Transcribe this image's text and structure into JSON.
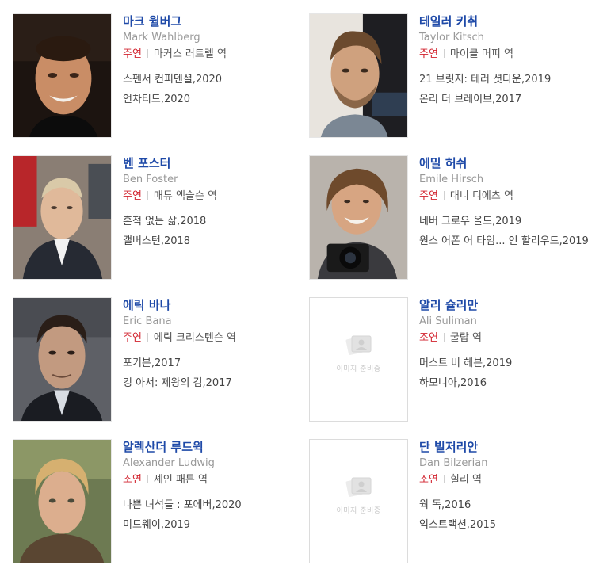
{
  "cast": [
    {
      "name_ko": "마크 월버그",
      "name_en": "Mark Wahlberg",
      "role_type": "주연",
      "role": "마커스 러트렐 역",
      "works": [
        "스펜서 컨피덴셜,2020",
        "언차티드,2020"
      ],
      "photo": "portrait"
    },
    {
      "name_ko": "테일러 키취",
      "name_en": "Taylor Kitsch",
      "role_type": "주연",
      "role": "마이클 머피 역",
      "works": [
        "21 브릿지: 테러 셧다운,2019",
        "온리 더 브레이브,2017"
      ],
      "photo": "portrait"
    },
    {
      "name_ko": "벤 포스터",
      "name_en": "Ben Foster",
      "role_type": "주연",
      "role": "매튜 액슬슨 역",
      "works": [
        "흔적 없는 삶,2018",
        "갤버스턴,2018"
      ],
      "photo": "portrait"
    },
    {
      "name_ko": "에밀 허쉬",
      "name_en": "Emile Hirsch",
      "role_type": "주연",
      "role": "대니 디에츠 역",
      "works": [
        "네버 그로우 올드,2019",
        "원스 어폰 어 타임... 인 할리우드,2019"
      ],
      "photo": "portrait"
    },
    {
      "name_ko": "에릭 바나",
      "name_en": "Eric Bana",
      "role_type": "주연",
      "role": "에릭 크리스텐슨 역",
      "works": [
        "포기븐,2017",
        "킹 아서: 제왕의 검,2017"
      ],
      "photo": "portrait"
    },
    {
      "name_ko": "알리 슐리만",
      "name_en": "Ali Suliman",
      "role_type": "조연",
      "role": "굴랍 역",
      "works": [
        "머스트 비 헤븐,2019",
        "하모니아,2016"
      ],
      "photo": "placeholder",
      "placeholder_text": "이미지 준비중"
    },
    {
      "name_ko": "알렉산더 루드윅",
      "name_en": "Alexander Ludwig",
      "role_type": "조연",
      "role": "셰인 패튼 역",
      "works": [
        "나쁜 녀석들 : 포에버,2020",
        "미드웨이,2019"
      ],
      "photo": "portrait"
    },
    {
      "name_ko": "단 빌저리안",
      "name_en": "Dan Bilzerian",
      "role_type": "조연",
      "role": "힐리 역",
      "works": [
        "웍 독,2016",
        "익스트랙션,2015"
      ],
      "photo": "placeholder",
      "placeholder_text": "이미지 준비중"
    }
  ],
  "colors": {
    "name_link": "#1f4aa8",
    "role_type": "#d2222d",
    "english_name": "#999999"
  }
}
